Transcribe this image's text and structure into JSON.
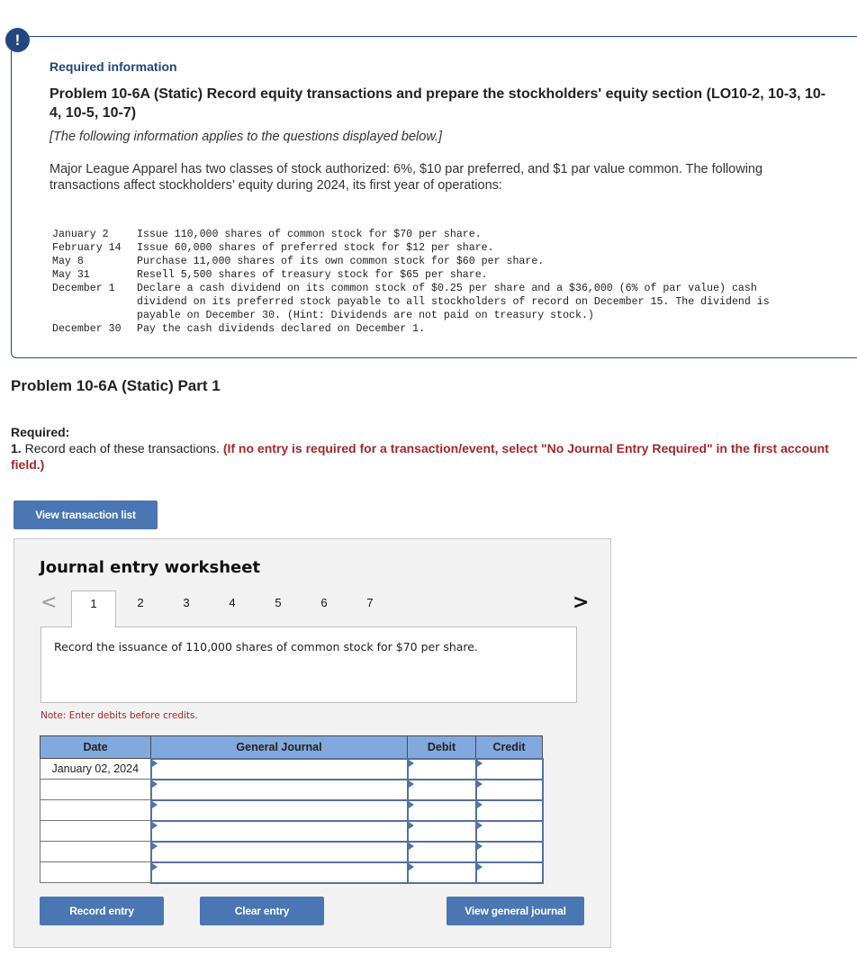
{
  "info": {
    "alert_icon": "!",
    "required_information": "Required information",
    "problem_title": "Problem 10-6A (Static) Record equity transactions and prepare the stockholders' equity section (LO10-2, 10-3, 10-4, 10-5, 10-7)",
    "applies_note": "[The following information applies to the questions displayed below.]",
    "intro": "Major League Apparel has two classes of stock authorized: 6%, $10 par preferred, and $1 par value common. The following transactions affect stockholders’ equity during 2024, its first year of operations:",
    "transactions": [
      {
        "date": "January 2",
        "description": "Issue 110,000 shares of common stock for $70 per share."
      },
      {
        "date": "February 14",
        "description": "Issue 60,000 shares of preferred stock for $12 per share."
      },
      {
        "date": "May 8",
        "description": "Purchase 11,000 shares of its own common stock for $60 per share."
      },
      {
        "date": "May 31",
        "description": "Resell 5,500 shares of treasury stock for $65 per share."
      },
      {
        "date": "December 1",
        "description": "Declare a cash dividend on its common stock of $0.25 per share and a $36,000 (6% of par value) cash dividend on its preferred stock payable to all stockholders of record on December 15. The dividend is payable on December 30. (Hint: Dividends are not paid on treasury stock.)"
      },
      {
        "date": "December 30",
        "description": "Pay the cash dividends declared on December 1."
      }
    ]
  },
  "part": {
    "title": "Problem 10-6A (Static) Part 1",
    "required_label": "Required:",
    "item_number": "1.",
    "item_text": " Record each of these transactions. ",
    "item_instruction": "(If no entry is required for a transaction/event, select \"No Journal Entry Required\" in the first account field.)",
    "view_transaction_list": "View transaction list"
  },
  "worksheet": {
    "title": "Journal entry worksheet",
    "prev_icon": "<",
    "next_icon": ">",
    "tabs": [
      "1",
      "2",
      "3",
      "4",
      "5",
      "6",
      "7"
    ],
    "active_tab": "1",
    "description": "Record the issuance of 110,000 shares of common stock for $70 per share.",
    "note": "Note: Enter debits before credits.",
    "columns": [
      "Date",
      "General Journal",
      "Debit",
      "Credit"
    ],
    "rows": [
      {
        "date": "January 02, 2024",
        "account": "",
        "debit": "",
        "credit": ""
      },
      {
        "date": "",
        "account": "",
        "debit": "",
        "credit": ""
      },
      {
        "date": "",
        "account": "",
        "debit": "",
        "credit": ""
      },
      {
        "date": "",
        "account": "",
        "debit": "",
        "credit": ""
      },
      {
        "date": "",
        "account": "",
        "debit": "",
        "credit": ""
      },
      {
        "date": "",
        "account": "",
        "debit": "",
        "credit": ""
      }
    ],
    "buttons": {
      "record": "Record entry",
      "clear": "Clear entry",
      "view_journal": "View general journal"
    }
  },
  "colors": {
    "brand_navy": "#22477e",
    "button_blue": "#4a76b4",
    "header_blue": "#82a9dd",
    "warning_red": "#a8262b"
  }
}
